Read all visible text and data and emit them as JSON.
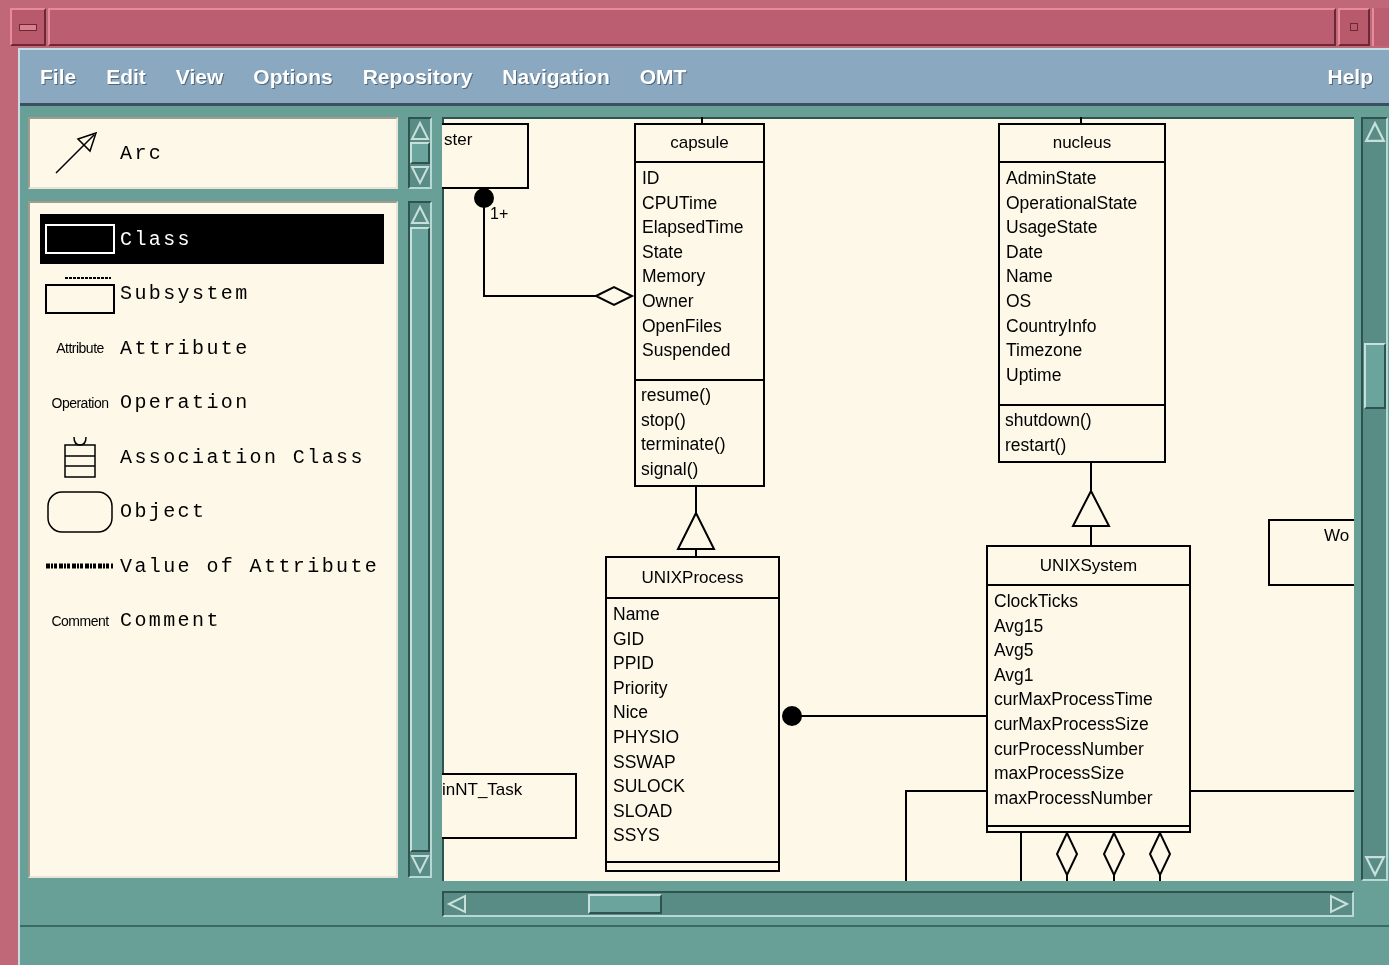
{
  "menu_bar": {
    "items": [
      "File",
      "Edit",
      "View",
      "Options",
      "Repository",
      "Navigation",
      "OMT"
    ],
    "help": "Help"
  },
  "palette": {
    "arc_tool": {
      "label": "Arc"
    },
    "items": [
      {
        "kind": "class",
        "label": "Class",
        "selected": true
      },
      {
        "kind": "subsystem",
        "label": "Subsystem",
        "selected": false
      },
      {
        "kind": "attribute",
        "label": "Attribute",
        "icon_label": "Attribute",
        "selected": false
      },
      {
        "kind": "operation",
        "label": "Operation",
        "icon_label": "Operation",
        "selected": false
      },
      {
        "kind": "association_class",
        "label": "Association Class",
        "selected": false
      },
      {
        "kind": "object",
        "label": "Object",
        "selected": false
      },
      {
        "kind": "value",
        "label": "Value of Attribute",
        "selected": false
      },
      {
        "kind": "comment",
        "label": "Comment",
        "icon_label": "Comment",
        "selected": false
      }
    ]
  },
  "diagram": {
    "classes": [
      {
        "name": "capsule",
        "attributes": [
          "ID",
          "CPUTime",
          "ElapsedTime",
          "State",
          "Memory",
          "Owner",
          "OpenFiles",
          "Suspended"
        ],
        "operations": [
          "resume()",
          "stop()",
          "terminate()",
          "signal()"
        ]
      },
      {
        "name": "nucleus",
        "attributes": [
          "AdminState",
          "OperationalState",
          "UsageState",
          "Date",
          "Name",
          "OS",
          "CountryInfo",
          "Timezone",
          "Uptime"
        ],
        "operations": [
          "shutdown()",
          "restart()"
        ]
      },
      {
        "name": "UNIXProcess",
        "attributes": [
          "Name",
          "GID",
          "PPID",
          "Priority",
          "Nice",
          "PHYSIO",
          "SSWAP",
          "SULOCK",
          "SLOAD",
          "SSYS"
        ]
      },
      {
        "name": "UNIXSystem",
        "attributes": [
          "ClockTicks",
          "Avg15",
          "Avg5",
          "Avg1",
          "curMaxProcessTime",
          "curMaxProcessSize",
          "curProcessNumber",
          "maxProcessSize",
          "maxProcessNumber"
        ]
      }
    ],
    "partial_boxes": [
      {
        "label": "ster"
      },
      {
        "label": "Wo"
      },
      {
        "label": "inNT_Task"
      }
    ],
    "multiplicity": "1+"
  }
}
